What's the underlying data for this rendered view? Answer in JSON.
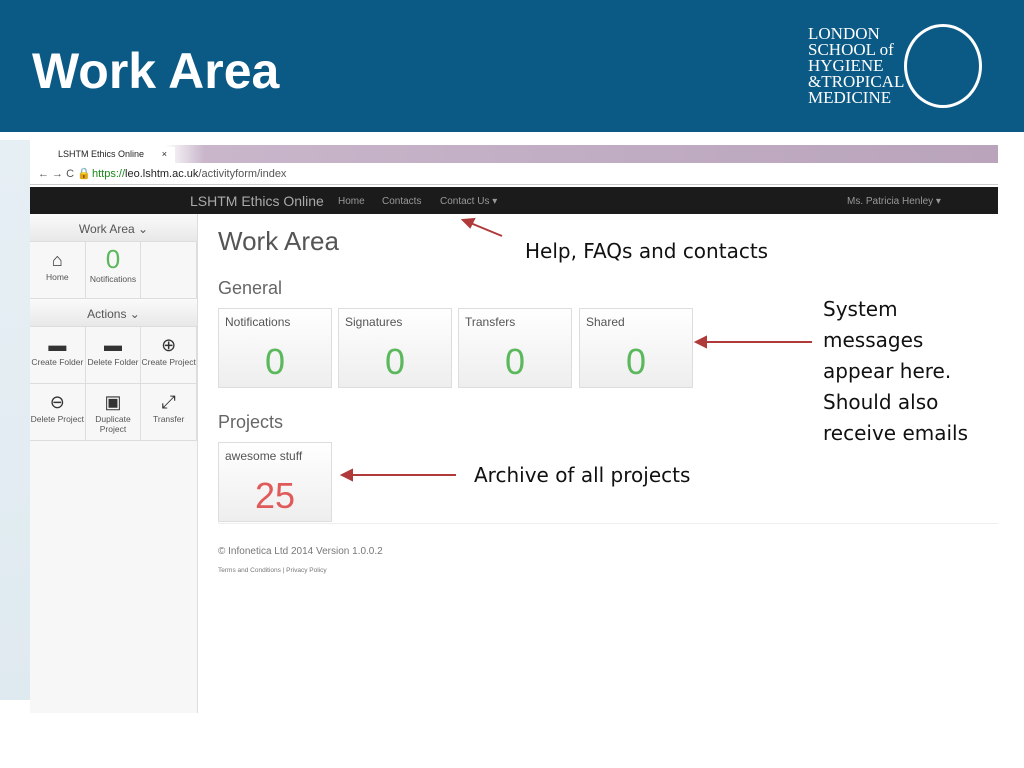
{
  "slide": {
    "title": "Work Area",
    "logo_lines": [
      "LONDON",
      "SCHOOL of",
      "HYGIENE",
      "&TROPICAL",
      "MEDICINE"
    ]
  },
  "browser": {
    "tab_title": "LSHTM Ethics Online",
    "tab_close": "×",
    "url_scheme": "https://",
    "url_host": "leo.lshtm.ac.uk",
    "url_path": "/activityform/index"
  },
  "navbar": {
    "brand": "LSHTM Ethics Online",
    "links": [
      "Home",
      "Contacts",
      "Contact Us ▾"
    ],
    "user": "Ms. Patricia Henley ▾"
  },
  "sidebar": {
    "work_area": "Work Area ⌄",
    "home": "Home",
    "notif_count": "0",
    "notifications": "Notifications",
    "actions": "Actions ⌄",
    "action_items": [
      "Create Folder",
      "Delete Folder",
      "Create Project",
      "Delete Project",
      "Duplicate Project",
      "Transfer"
    ]
  },
  "main": {
    "title": "Work Area",
    "general": "General",
    "cards": [
      {
        "label": "Notifications",
        "value": "0"
      },
      {
        "label": "Signatures",
        "value": "0"
      },
      {
        "label": "Transfers",
        "value": "0"
      },
      {
        "label": "Shared",
        "value": "0"
      }
    ],
    "projects": "Projects",
    "project": {
      "label": "awesome stuff",
      "value": "25"
    },
    "footer": "© Infonetica Ltd 2014 Version 1.0.0.2",
    "footer_links": "Terms and Conditions | Privacy Policy"
  },
  "notes": {
    "help": "Help, FAQs and contacts",
    "system": "System messages appear here. Should also receive emails",
    "archive": "Archive of all projects"
  },
  "colors": {
    "header": "#0b5a86",
    "zero": "#5cb85c",
    "project_count": "#e05a5a",
    "arrow": "#b03a3a"
  }
}
